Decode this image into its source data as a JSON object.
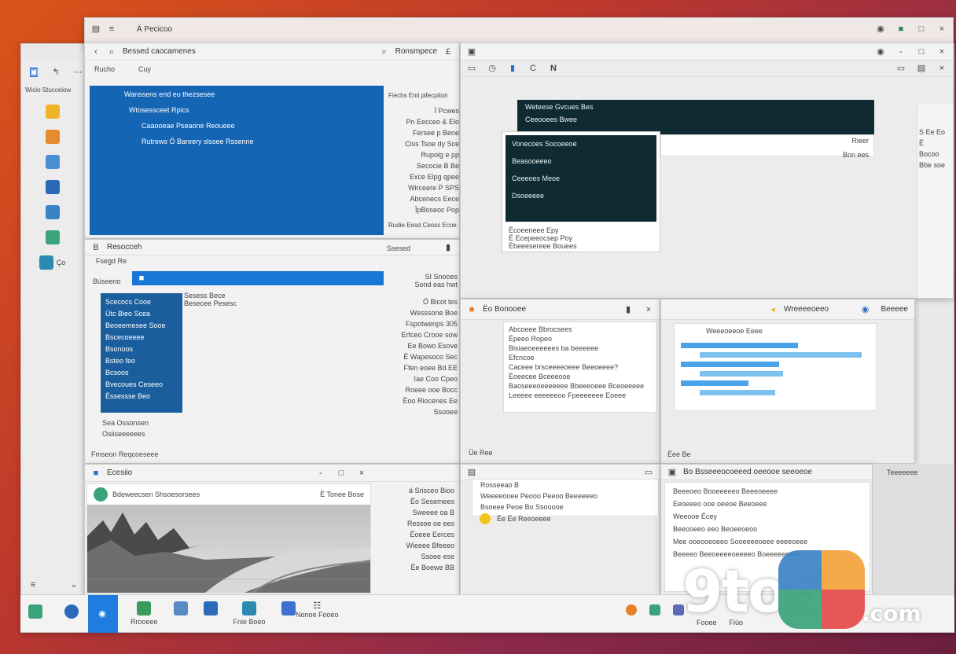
{
  "main_window": {
    "title": "Ä Pecicoo",
    "controls": [
      "-",
      "□",
      "×"
    ]
  },
  "left_sidebar": {
    "label": "Wicio Stucceiow",
    "icons": [
      "folder-icon",
      "files-icon",
      "docs-icon",
      "app-icon",
      "store-icon",
      "photos-icon",
      "camera-icon"
    ],
    "sub": "Ço"
  },
  "win_a": {
    "title": "Bessed caocamenes",
    "search": "Ronsmpece",
    "menu": [
      "Rucho",
      "Cuy"
    ],
    "items": [
      "Wanssens end eu thezsesee",
      "Wtosessceet Rpics",
      "Caaooeae Pseaone Reoueee",
      "Rutrews Ö Bareery slssee Rssenne"
    ],
    "right_title": "Fiechs Enil pifecpiton",
    "right_list": [
      "Ï Pcwes",
      "Pn Eecceo & Elo",
      "Fersee p Bene",
      "Ciss Tsoe dy Sce",
      "Rupolg e pp",
      "Secocie B Be",
      "Exce Elpg qpee",
      "Wirceere P SPS",
      "Abcenecs Eece",
      "ÏpBoseoc Pop"
    ],
    "footer": "Rudie Eesd Ceoss Ecoe"
  },
  "win_b": {
    "title": "Resocceh",
    "tab": "Fsegd Re",
    "sub": "Büseeno",
    "list": [
      "Scecocs Cooe",
      "Ütc Bieo Scea",
      "Beoeemesee Sooe",
      "Bscecoeeee",
      "Bsonoos",
      "Bsteo feo",
      "Bcsoos",
      "Bvecoues Ceseeo",
      "Ëssessse Beo"
    ],
    "side_text": [
      "Sesess Bece",
      "Besecee Pesesc"
    ],
    "extra": [
      "Sea Ossonsen",
      "Osiiseeeeees"
    ],
    "footer": "Fmseon Reqcoeseee",
    "right_title": "Ssesed",
    "right_meta": [
      "SI Snooes",
      "Sond eas hwt"
    ],
    "right_list": [
      "Ö Bicot tes",
      "Wesssone Boe",
      "Fspotwenps 305",
      "Erfceo Crooe sow",
      "Ee Bowo Esove",
      "Ë Wapesoco Sec",
      "Ffen eoee Bd EE",
      "Iae Coo Cpeo",
      "Roeee ooe Bocc",
      "Ëoo Riocenes Ee",
      "Ssooee"
    ]
  },
  "win_c": {
    "title": "Ecesiio",
    "card_title": "Bdeweecsen Shsoesorsees",
    "card_sub": "Ë Tonee Bose",
    "right_list": [
      "ä Srisceo Bioo",
      "Ëo Sesemees",
      "Sweeee oa B",
      "Ressoe oe ees",
      "Ëoeee Eerces",
      "Wieeee Bfeeeo",
      "Ssoee ese",
      "Ëe Boewe BB"
    ]
  },
  "win_d": {
    "title": "N",
    "dark_items": [
      "Weteese Gvcues Bes",
      "Ceeooees Bwee",
      "Vonecoes Socoeeoe",
      "Beasooeeeo",
      "Ceeeoes Meoe",
      "Dsoeeeee"
    ],
    "footer_items": [
      "Ëcoeeneee Epy",
      "Ë Ecepeeocsep Poy",
      "Ëbeeesereee Bouees"
    ],
    "side": [
      "Rieer",
      "Bon ees"
    ],
    "far_right": [
      "S Ee Eo",
      "Ë",
      "Bocoo",
      "Bbe soe"
    ]
  },
  "win_e": {
    "title": "Ëo Bonooee",
    "list": [
      "Abcoeee Bbrocsees",
      "Ëpeeo Ropeo",
      "Bisiaeoeeeeees ba beeeeee",
      "Efcncoe",
      "Caceee brsceeeeoeee Beeoeeee?",
      "Ëoeecee Bceeeooe",
      "Baoseeeoeeeeeee Bbeeeoeee Bceoeeeee",
      "Leeeee eeeeeeoo Fpeeeeeee Eoeee"
    ],
    "footer": "Üe Ree"
  },
  "win_f": {
    "title": "Wreeeeoeeo",
    "sub": "Weeeoeeoe Eeee",
    "tag": "Beeeee",
    "footer": "Ëee Be",
    "bars": [
      0.62,
      0.86,
      0.52,
      0.44,
      0.36,
      0.4
    ]
  },
  "win_g": {
    "title": "Rosseeao B",
    "items": [
      "Weeeeooee Peooo Peeoo Beeeeeeo",
      "Bsoeee Peoe Bo Ssooooe",
      "Ëe Ëe Reeoeeee"
    ]
  },
  "win_h": {
    "title": "Bo Bsseeeocoeeed oeeooe seeoeoe",
    "items": [
      "Beeeoeo Booeeeeeo Beeeoeeee",
      "Eeoeeeo ooe oeeoe Beeoeee",
      "Weeooe Ëcey",
      "Beeooeeo eeo Beoeeoeoo",
      "Mee ooeooeoeeo Sooeeeeoeee eeeeoeee",
      "Beeeeo Beeoeeeeoeeeeo Boeeeeeeeeo"
    ],
    "far_right": [
      "Teeeeeee"
    ]
  },
  "taskbar": {
    "items": [
      "Rrooeee",
      "Fnie Boeo",
      "Nonoe Fooeo",
      "Fooee",
      "Fiüo"
    ],
    "watermark_brand": "9to5",
    "watermark_suffix": ".com"
  }
}
